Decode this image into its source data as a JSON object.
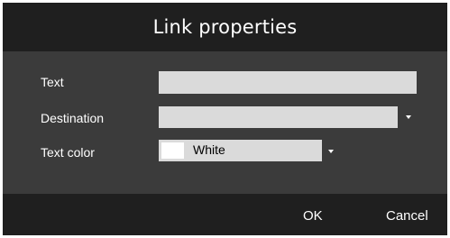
{
  "dialog": {
    "title": "Link properties",
    "fields": {
      "text_label": "Text",
      "text_value": "",
      "destination_label": "Destination",
      "destination_value": "",
      "text_color_label": "Text color",
      "text_color_value": "White",
      "text_color_swatch": "#ffffff"
    },
    "buttons": {
      "ok": "OK",
      "cancel": "Cancel"
    }
  },
  "colors": {
    "titlebar": "#1f1f1f",
    "content": "#3b3b3b",
    "field": "#dadada"
  },
  "icons": {
    "dropdown": "chevron-down-icon"
  }
}
